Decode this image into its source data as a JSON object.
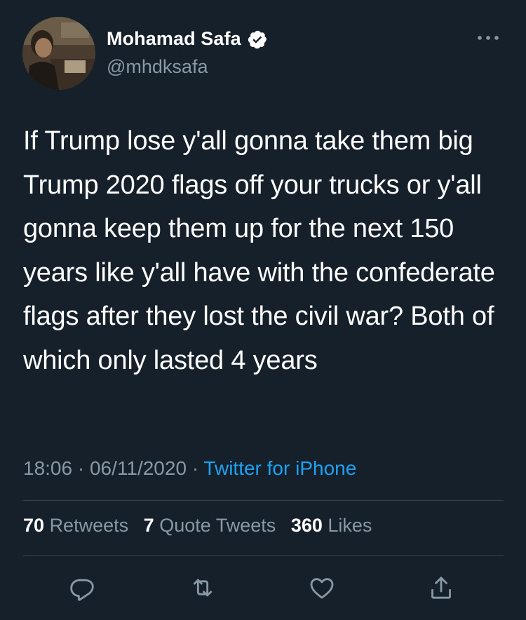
{
  "author": {
    "display_name": "Mohamad Safa",
    "handle": "@mhdksafa",
    "verified": true
  },
  "tweet": {
    "text": "If Trump lose y'all gonna take them big Trump 2020 flags off your trucks or y'all gonna keep them up for the next 150 years like y'all have with the confederate flags after they lost the civil war? Both of which only lasted 4 years",
    "time": "18:06",
    "date": "06/11/2020",
    "source": "Twitter for iPhone"
  },
  "stats": {
    "retweets_count": "70",
    "retweets_label": "Retweets",
    "quotes_count": "7",
    "quotes_label": "Quote Tweets",
    "likes_count": "360",
    "likes_label": "Likes"
  },
  "colors": {
    "background": "#15202b",
    "secondary_text": "#8899a6",
    "accent": "#1da1f2",
    "divider": "#38444d"
  },
  "icons": {
    "more": "more-horizontal-icon",
    "reply": "reply-icon",
    "retweet": "retweet-icon",
    "like": "heart-icon",
    "share": "share-icon",
    "verified": "verified-badge-icon"
  }
}
